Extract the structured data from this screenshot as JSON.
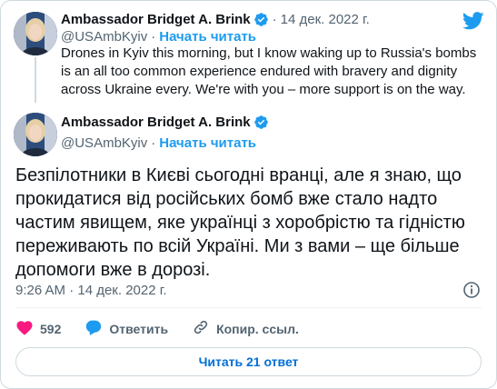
{
  "quoted_tweet": {
    "author_name": "Ambassador Bridget A. Brink",
    "date_separator": "·",
    "date": "14 дек. 2022 г.",
    "handle": "@USAmbKyiv",
    "handle_separator": "·",
    "follow_label": "Начать читать",
    "text": "Drones in Kyiv this morning, but I know waking up to Russia's bombs is an all too common experience endured with bravery and dignity across Ukraine every. We're with you – more support is on the way."
  },
  "main_tweet": {
    "author_name": "Ambassador Bridget A. Brink",
    "handle": "@USAmbKyiv",
    "handle_separator": "·",
    "follow_label": "Начать читать",
    "text": "Безпілотники в Києві сьогодні вранці, але я знаю, що прокидатися від російських бомб вже стало надто частим явищем, яке українці з хоробрістю та гідністю переживають по всій Україні. Ми з вами – ще більше допомоги вже в дорозі.",
    "timestamp": "9:26 AM · 14 дек. 2022 г."
  },
  "actions": {
    "like_count": "592",
    "reply_label": "Ответить",
    "copy_link_label": "Копир. ссыл."
  },
  "read_replies_label": "Читать 21 ответ",
  "icons": {
    "brand": "twitter-bird-icon",
    "verified": "verified-badge-icon",
    "info": "info-icon",
    "like": "heart-icon",
    "reply": "reply-bubble-icon",
    "link": "link-icon"
  },
  "colors": {
    "brand_blue": "#1d9bf0",
    "like_pink": "#f91880",
    "muted_text": "#536471",
    "border": "#cfd9de"
  }
}
